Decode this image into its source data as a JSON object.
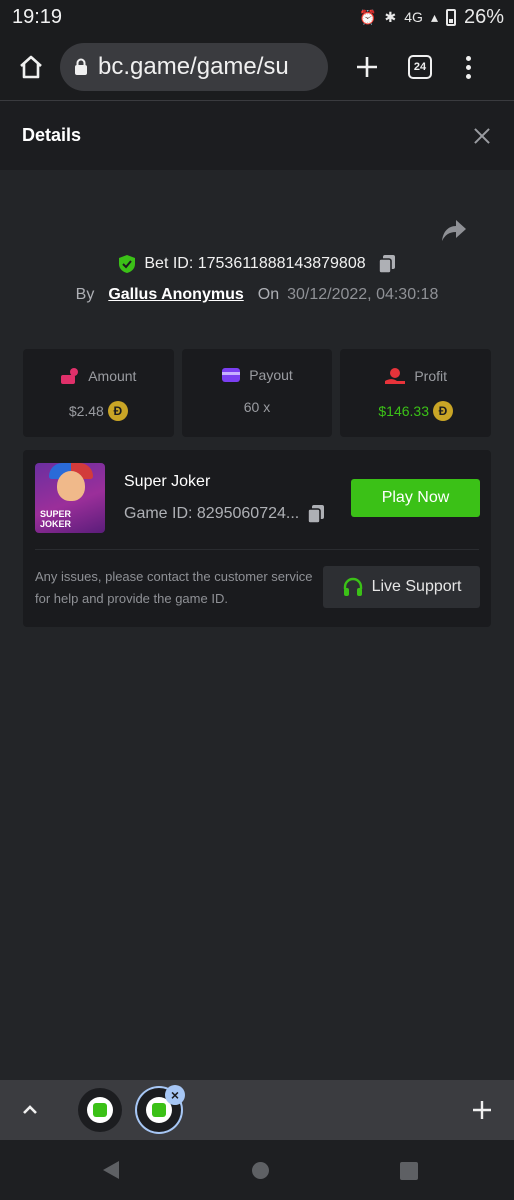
{
  "status_bar": {
    "time": "19:19",
    "network": "4G",
    "battery": "26%"
  },
  "browser": {
    "url": "bc.game/game/su",
    "tab_count": "24"
  },
  "details": {
    "title": "Details",
    "bet_id": "Bet ID: 1753611888143879808",
    "by_label": "By",
    "username": "Gallus Anonymus",
    "on_label": "On",
    "datetime": "30/12/2022, 04:30:18"
  },
  "stats": {
    "amount": {
      "label": "Amount",
      "value": "$2.48"
    },
    "payout": {
      "label": "Payout",
      "value": "60 x"
    },
    "profit": {
      "label": "Profit",
      "value": "$146.33"
    },
    "coin_symbol": "Đ"
  },
  "game": {
    "name": "Super Joker",
    "thumb_text_1": "SUPER",
    "thumb_text_2": "JOKER",
    "game_id": "Game ID: 8295060724...",
    "play_label": "Play Now",
    "issue_text": "Any issues, please contact the customer service for help and provide the game ID.",
    "live_support_label": "Live Support"
  },
  "colors": {
    "accent_green": "#3bc117",
    "background": "#232528",
    "card": "#1a1b1e"
  }
}
